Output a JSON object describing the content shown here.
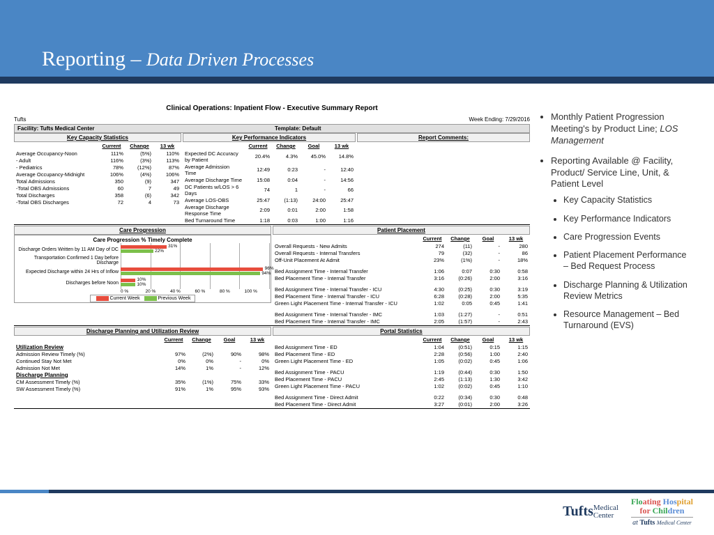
{
  "slide": {
    "title_main": "Reporting – ",
    "title_sub": "Data Driven Processes"
  },
  "report": {
    "title": "Clinical Operations: Inpatient Flow - Executive Summary Report",
    "org": "Tufts",
    "week_ending_label": "Week Ending: 7/29/2016",
    "facility_label": "Facility: Tufts Medical Center",
    "template_label": "Template: Default",
    "sections": {
      "kcs": "Key Capacity Statistics",
      "kpi": "Key Performance Indicators",
      "rc": "Report Comments:",
      "care": "Care Progression",
      "pp": "Patient Placement",
      "dpu": "Discharge Planning and Utilization Review",
      "portal": "Portal Statistics"
    },
    "cols": {
      "current": "Current",
      "change": "Change",
      "goal": "Goal",
      "wk13": "13 wk"
    },
    "kcs_rows": [
      {
        "lbl": "Average Occupancy-Noon",
        "cur": "111%",
        "chg": "(5%)",
        "wk": "110%"
      },
      {
        "lbl": " - Adult",
        "cur": "116%",
        "chg": "(3%)",
        "wk": "113%"
      },
      {
        "lbl": " - Pediatrics",
        "cur": "78%",
        "chg": "(12%)",
        "wk": "87%"
      },
      {
        "lbl": "Average Occupancy-Midnight",
        "cur": "106%",
        "chg": "(4%)",
        "wk": "106%"
      },
      {
        "lbl": "Total Admissions",
        "cur": "350",
        "chg": "(9)",
        "wk": "347"
      },
      {
        "lbl": " -Total OBS Admissions",
        "cur": "60",
        "chg": "7",
        "wk": "49"
      },
      {
        "lbl": "Total Discharges",
        "cur": "358",
        "chg": "(6)",
        "wk": "342"
      },
      {
        "lbl": " -Total OBS Discharges",
        "cur": "72",
        "chg": "4",
        "wk": "73"
      }
    ],
    "kpi_rows": [
      {
        "lbl": "Expected DC Accuracy by Patient",
        "cur": "20.4%",
        "chg": "4.3%",
        "goal": "45.0%",
        "wk": "14.8%"
      },
      {
        "lbl": "Average Admission Time",
        "cur": "12:49",
        "chg": "0:23",
        "goal": "-",
        "wk": "12:40"
      },
      {
        "lbl": "Average Discharge Time",
        "cur": "15:08",
        "chg": "0:04",
        "goal": "-",
        "wk": "14:56"
      },
      {
        "lbl": "DC Patients w/LOS > 6 Days",
        "cur": "74",
        "chg": "1",
        "goal": "-",
        "wk": "66"
      },
      {
        "lbl": "Average LOS-OBS",
        "cur": "25:47",
        "chg": "(1:13)",
        "goal": "24:00",
        "wk": "25:47"
      },
      {
        "lbl": "Average Discharge Response Time",
        "cur": "2:09",
        "chg": "0:01",
        "goal": "2:00",
        "wk": "1:58"
      },
      {
        "lbl": "Bed Turnaround Time",
        "cur": "1:18",
        "chg": "0:03",
        "goal": "1:00",
        "wk": "1:16"
      }
    ],
    "care_chart": {
      "title": "Care Progression % Timely Complete",
      "xticks": [
        "0 %",
        "20 %",
        "40 %",
        "60 %",
        "80 %",
        "100 %"
      ],
      "legend_cur": "Current Week",
      "legend_prev": "Previous Week",
      "rows": [
        {
          "lbl": "Discharge Orders Written by 11 AM Day of DC",
          "cur": 31,
          "prev": 22
        },
        {
          "lbl": "Transportation Confirmed 1 Day before Discharge",
          "cur": 0,
          "prev": 0
        },
        {
          "lbl": "Expected Discharge within 24 Hrs of Inflow",
          "cur": 96,
          "prev": 94
        },
        {
          "lbl": "Discharges before Noon",
          "cur": 10,
          "prev": 10
        }
      ]
    },
    "pp_rows1": [
      {
        "lbl": "Overall Requests - New Admits",
        "cur": "274",
        "chg": "(11)",
        "goal": "-",
        "wk": "280"
      },
      {
        "lbl": "Overall Requests - Internal Transfers",
        "cur": "79",
        "chg": "(32)",
        "goal": "-",
        "wk": "86"
      },
      {
        "lbl": "Off-Unit Placement At Admit",
        "cur": "23%",
        "chg": "(1%)",
        "goal": "-",
        "wk": "18%"
      }
    ],
    "pp_rows2": [
      {
        "lbl": "Bed Assignment Time - Internal Transfer",
        "cur": "1:06",
        "chg": "0:07",
        "goal": "0:30",
        "wk": "0:58"
      },
      {
        "lbl": "Bed Placement Time - Internal Transfer",
        "cur": "3:16",
        "chg": "(0:26)",
        "goal": "2:00",
        "wk": "3:16"
      }
    ],
    "pp_rows3": [
      {
        "lbl": "Bed Assignment Time - Internal Transfer - ICU",
        "cur": "4:30",
        "chg": "(0:25)",
        "goal": "0:30",
        "wk": "3:19"
      },
      {
        "lbl": "Bed Placement Time - Internal Transfer - ICU",
        "cur": "6:28",
        "chg": "(0:28)",
        "goal": "2:00",
        "wk": "5:35"
      },
      {
        "lbl": "Green Light Placement Time - Internal Transfer - ICU",
        "cur": "1:02",
        "chg": "0:05",
        "goal": "0:45",
        "wk": "1:41"
      }
    ],
    "pp_rows4": [
      {
        "lbl": "Bed Assignment Time - Internal Transfer - IMC",
        "cur": "1:03",
        "chg": "(1:27)",
        "goal": "-",
        "wk": "0:51"
      },
      {
        "lbl": "Bed Placement Time - Internal Transfer - IMC",
        "cur": "2:05",
        "chg": "(1:57)",
        "goal": "-",
        "wk": "2:43"
      }
    ],
    "dpu": {
      "ur_head": "Utilization Review",
      "dp_head": "Discharge Planning",
      "ur_rows": [
        {
          "lbl": "Admission Review Timely (%)",
          "cur": "97%",
          "chg": "(2%)",
          "goal": "90%",
          "wk": "98%"
        },
        {
          "lbl": "Continued Stay Not Met",
          "cur": "0%",
          "chg": "0%",
          "goal": "-",
          "wk": "0%"
        },
        {
          "lbl": "Admission Not Met",
          "cur": "14%",
          "chg": "1%",
          "goal": "-",
          "wk": "12%"
        }
      ],
      "dp_rows": [
        {
          "lbl": "CM Assessment Timely (%)",
          "cur": "35%",
          "chg": "(1%)",
          "goal": "75%",
          "wk": "33%"
        },
        {
          "lbl": "SW Assessment Timely (%)",
          "cur": "91%",
          "chg": "1%",
          "goal": "95%",
          "wk": "93%"
        }
      ]
    },
    "portal_rows1": [
      {
        "lbl": "Bed Assignment Time - ED",
        "cur": "1:04",
        "chg": "(0:51)",
        "goal": "0:15",
        "wk": "1:15"
      },
      {
        "lbl": "Bed Placement Time - ED",
        "cur": "2:28",
        "chg": "(0:56)",
        "goal": "1:00",
        "wk": "2:40"
      },
      {
        "lbl": "Green Light Placement Time - ED",
        "cur": "1:05",
        "chg": "(0:02)",
        "goal": "0:45",
        "wk": "1:06"
      }
    ],
    "portal_rows2": [
      {
        "lbl": "Bed Assignment Time - PACU",
        "cur": "1:19",
        "chg": "(0:44)",
        "goal": "0:30",
        "wk": "1:50"
      },
      {
        "lbl": "Bed Placement Time - PACU",
        "cur": "2:45",
        "chg": "(1:13)",
        "goal": "1:30",
        "wk": "3:42"
      },
      {
        "lbl": "Green Light Placement Time - PACU",
        "cur": "1:02",
        "chg": "(0:02)",
        "goal": "0:45",
        "wk": "1:10"
      }
    ],
    "portal_rows3": [
      {
        "lbl": "Bed Assignment Time - Direct Admit",
        "cur": "0:22",
        "chg": "(0:34)",
        "goal": "0:30",
        "wk": "0:48"
      },
      {
        "lbl": "Bed Placement Time - Direct Admit",
        "cur": "3:27",
        "chg": "(0:01)",
        "goal": "2:00",
        "wk": "3:26"
      }
    ]
  },
  "chart_data": {
    "type": "bar",
    "orientation": "horizontal",
    "title": "Care Progression % Timely Complete",
    "xlabel": "",
    "ylabel": "",
    "xlim": [
      0,
      100
    ],
    "categories": [
      "Discharge Orders Written by 11 AM Day of DC",
      "Transportation Confirmed 1 Day before Discharge",
      "Expected Discharge within 24 Hrs of Inflow",
      "Discharges before Noon"
    ],
    "series": [
      {
        "name": "Current Week",
        "color": "#e74c3c",
        "values": [
          31,
          0,
          96,
          10
        ]
      },
      {
        "name": "Previous Week",
        "color": "#7cc04b",
        "values": [
          22,
          0,
          94,
          10
        ]
      }
    ],
    "xticks": [
      0,
      20,
      40,
      60,
      80,
      100
    ]
  },
  "bullets": {
    "b1a": "Monthly Patient Progression Meeting's by Product Line; ",
    "b1b": "LOS Management",
    "b2": "Reporting Available @ Facility, Product/ Service Line, Unit, & Patient Level",
    "sub": [
      "Key Capacity Statistics",
      "Key Performance Indicators",
      "Care Progression Events",
      "Patient Placement Performance – Bed Request Process",
      "Discharge Planning & Utilization Review Metrics",
      "Resource Management – Bed Turnaround (EVS)"
    ]
  },
  "logos": {
    "tufts_big": "Tufts",
    "tufts_small": "Medical\nCenter",
    "fh_l1": "Floating Hospital",
    "fh_l2": "for Children",
    "fh_at": "at ",
    "fh_tufts": "Tufts",
    "fh_mc": "Medical Center"
  }
}
